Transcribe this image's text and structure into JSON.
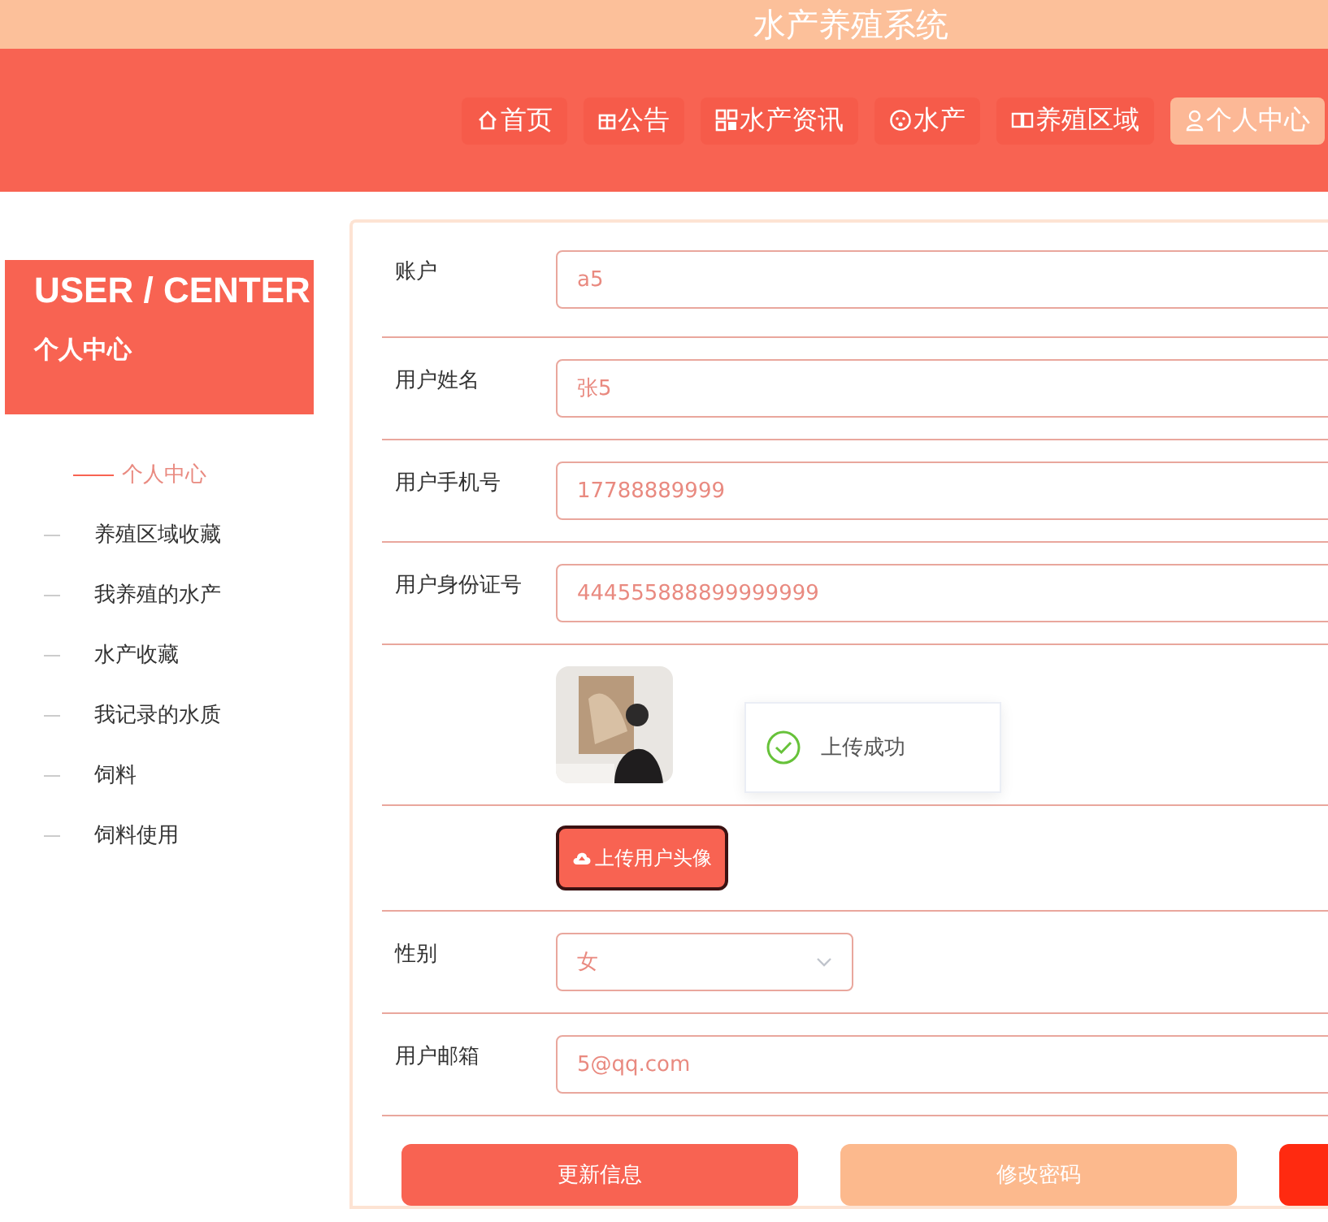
{
  "site_title": "水产养殖系统",
  "nav": [
    {
      "label": "首页",
      "kind": "home",
      "selected": false
    },
    {
      "label": "公告",
      "kind": "notice",
      "selected": false
    },
    {
      "label": "水产资讯",
      "kind": "news",
      "selected": false
    },
    {
      "label": "水产",
      "kind": "product",
      "selected": false
    },
    {
      "label": "养殖区域",
      "kind": "area",
      "selected": false
    },
    {
      "label": "个人中心",
      "kind": "user",
      "selected": true
    }
  ],
  "sidebar": {
    "heading": "USER / CENTER",
    "subheading": "个人中心",
    "items": [
      {
        "label": "个人中心",
        "selected": true
      },
      {
        "label": "养殖区域收藏",
        "selected": false
      },
      {
        "label": "我养殖的水产",
        "selected": false
      },
      {
        "label": "水产收藏",
        "selected": false
      },
      {
        "label": "我记录的水质",
        "selected": false
      },
      {
        "label": "饲料",
        "selected": false
      },
      {
        "label": "饲料使用",
        "selected": false
      }
    ]
  },
  "form": {
    "fields": [
      {
        "kind": "text",
        "label": "账户",
        "value": "a5"
      },
      {
        "kind": "text",
        "label": "用户姓名",
        "value": "张5"
      },
      {
        "kind": "text",
        "label": "用户手机号",
        "value": "17788889999"
      },
      {
        "kind": "text",
        "label": "用户身份证号",
        "value": "444555888899999999"
      },
      {
        "kind": "avatar",
        "toast": "上传成功"
      },
      {
        "kind": "upload",
        "button": "上传用户头像"
      },
      {
        "kind": "select",
        "label": "性别",
        "value": "女"
      },
      {
        "kind": "text",
        "label": "用户邮箱",
        "value": "5@qq.com"
      }
    ],
    "buttons": [
      {
        "label": "更新信息",
        "kind": "primary"
      },
      {
        "label": "修改密码",
        "kind": "secondary"
      },
      {
        "kind": "danger"
      }
    ]
  }
}
